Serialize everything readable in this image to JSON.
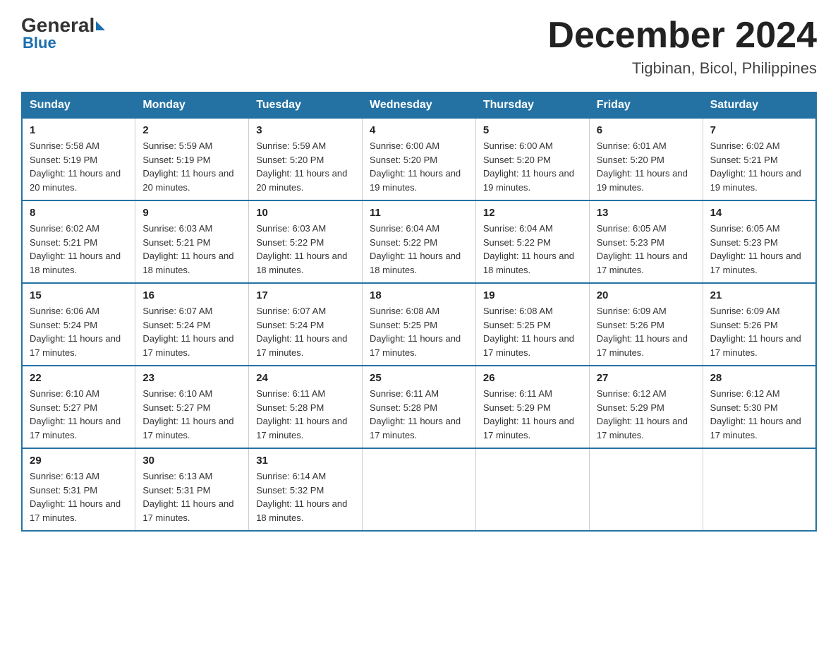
{
  "logo": {
    "general": "General",
    "blue": "Blue"
  },
  "title": {
    "month": "December 2024",
    "location": "Tigbinan, Bicol, Philippines"
  },
  "weekdays": [
    "Sunday",
    "Monday",
    "Tuesday",
    "Wednesday",
    "Thursday",
    "Friday",
    "Saturday"
  ],
  "weeks": [
    [
      {
        "day": "1",
        "sunrise": "5:58 AM",
        "sunset": "5:19 PM",
        "daylight": "11 hours and 20 minutes."
      },
      {
        "day": "2",
        "sunrise": "5:59 AM",
        "sunset": "5:19 PM",
        "daylight": "11 hours and 20 minutes."
      },
      {
        "day": "3",
        "sunrise": "5:59 AM",
        "sunset": "5:20 PM",
        "daylight": "11 hours and 20 minutes."
      },
      {
        "day": "4",
        "sunrise": "6:00 AM",
        "sunset": "5:20 PM",
        "daylight": "11 hours and 19 minutes."
      },
      {
        "day": "5",
        "sunrise": "6:00 AM",
        "sunset": "5:20 PM",
        "daylight": "11 hours and 19 minutes."
      },
      {
        "day": "6",
        "sunrise": "6:01 AM",
        "sunset": "5:20 PM",
        "daylight": "11 hours and 19 minutes."
      },
      {
        "day": "7",
        "sunrise": "6:02 AM",
        "sunset": "5:21 PM",
        "daylight": "11 hours and 19 minutes."
      }
    ],
    [
      {
        "day": "8",
        "sunrise": "6:02 AM",
        "sunset": "5:21 PM",
        "daylight": "11 hours and 18 minutes."
      },
      {
        "day": "9",
        "sunrise": "6:03 AM",
        "sunset": "5:21 PM",
        "daylight": "11 hours and 18 minutes."
      },
      {
        "day": "10",
        "sunrise": "6:03 AM",
        "sunset": "5:22 PM",
        "daylight": "11 hours and 18 minutes."
      },
      {
        "day": "11",
        "sunrise": "6:04 AM",
        "sunset": "5:22 PM",
        "daylight": "11 hours and 18 minutes."
      },
      {
        "day": "12",
        "sunrise": "6:04 AM",
        "sunset": "5:22 PM",
        "daylight": "11 hours and 18 minutes."
      },
      {
        "day": "13",
        "sunrise": "6:05 AM",
        "sunset": "5:23 PM",
        "daylight": "11 hours and 17 minutes."
      },
      {
        "day": "14",
        "sunrise": "6:05 AM",
        "sunset": "5:23 PM",
        "daylight": "11 hours and 17 minutes."
      }
    ],
    [
      {
        "day": "15",
        "sunrise": "6:06 AM",
        "sunset": "5:24 PM",
        "daylight": "11 hours and 17 minutes."
      },
      {
        "day": "16",
        "sunrise": "6:07 AM",
        "sunset": "5:24 PM",
        "daylight": "11 hours and 17 minutes."
      },
      {
        "day": "17",
        "sunrise": "6:07 AM",
        "sunset": "5:24 PM",
        "daylight": "11 hours and 17 minutes."
      },
      {
        "day": "18",
        "sunrise": "6:08 AM",
        "sunset": "5:25 PM",
        "daylight": "11 hours and 17 minutes."
      },
      {
        "day": "19",
        "sunrise": "6:08 AM",
        "sunset": "5:25 PM",
        "daylight": "11 hours and 17 minutes."
      },
      {
        "day": "20",
        "sunrise": "6:09 AM",
        "sunset": "5:26 PM",
        "daylight": "11 hours and 17 minutes."
      },
      {
        "day": "21",
        "sunrise": "6:09 AM",
        "sunset": "5:26 PM",
        "daylight": "11 hours and 17 minutes."
      }
    ],
    [
      {
        "day": "22",
        "sunrise": "6:10 AM",
        "sunset": "5:27 PM",
        "daylight": "11 hours and 17 minutes."
      },
      {
        "day": "23",
        "sunrise": "6:10 AM",
        "sunset": "5:27 PM",
        "daylight": "11 hours and 17 minutes."
      },
      {
        "day": "24",
        "sunrise": "6:11 AM",
        "sunset": "5:28 PM",
        "daylight": "11 hours and 17 minutes."
      },
      {
        "day": "25",
        "sunrise": "6:11 AM",
        "sunset": "5:28 PM",
        "daylight": "11 hours and 17 minutes."
      },
      {
        "day": "26",
        "sunrise": "6:11 AM",
        "sunset": "5:29 PM",
        "daylight": "11 hours and 17 minutes."
      },
      {
        "day": "27",
        "sunrise": "6:12 AM",
        "sunset": "5:29 PM",
        "daylight": "11 hours and 17 minutes."
      },
      {
        "day": "28",
        "sunrise": "6:12 AM",
        "sunset": "5:30 PM",
        "daylight": "11 hours and 17 minutes."
      }
    ],
    [
      {
        "day": "29",
        "sunrise": "6:13 AM",
        "sunset": "5:31 PM",
        "daylight": "11 hours and 17 minutes."
      },
      {
        "day": "30",
        "sunrise": "6:13 AM",
        "sunset": "5:31 PM",
        "daylight": "11 hours and 17 minutes."
      },
      {
        "day": "31",
        "sunrise": "6:14 AM",
        "sunset": "5:32 PM",
        "daylight": "11 hours and 18 minutes."
      },
      null,
      null,
      null,
      null
    ]
  ],
  "labels": {
    "sunrise": "Sunrise:",
    "sunset": "Sunset:",
    "daylight": "Daylight:"
  }
}
